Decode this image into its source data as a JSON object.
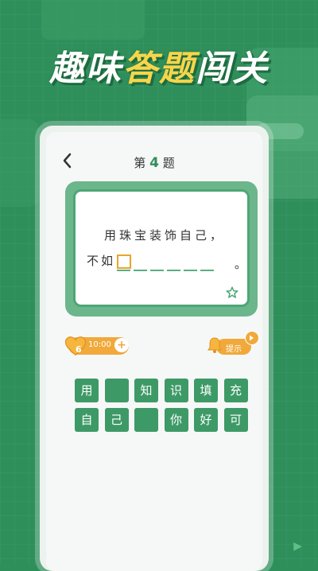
{
  "headline": {
    "part1": "趣味",
    "highlight": "答题",
    "part2": "闯关"
  },
  "header": {
    "back_icon": "chevron-left-icon",
    "title_prefix": "第",
    "level_number": "4",
    "title_suffix": "题"
  },
  "question": {
    "line1": "用珠宝装饰自己，",
    "line2_prefix": "不如",
    "blank_count": 6,
    "line2_suffix": "。",
    "favorite_icon": "star-icon"
  },
  "helpers": {
    "lives_count": "6",
    "timer": "10:00",
    "add_label": "+",
    "hint_label": "提示"
  },
  "choices": [
    {
      "text": "用",
      "filled": true
    },
    {
      "text": "",
      "filled": false
    },
    {
      "text": "知",
      "filled": true
    },
    {
      "text": "识",
      "filled": true
    },
    {
      "text": "填",
      "filled": true
    },
    {
      "text": "充",
      "filled": true
    },
    {
      "text": "自",
      "filled": true
    },
    {
      "text": "己",
      "filled": true
    },
    {
      "text": "",
      "filled": false
    },
    {
      "text": "你",
      "filled": true
    },
    {
      "text": "好",
      "filled": true
    },
    {
      "text": "可",
      "filled": true
    }
  ],
  "colors": {
    "brand_green": "#2f8f5b",
    "accent_orange": "#f0a93a",
    "headline_yellow": "#f7d54a"
  }
}
